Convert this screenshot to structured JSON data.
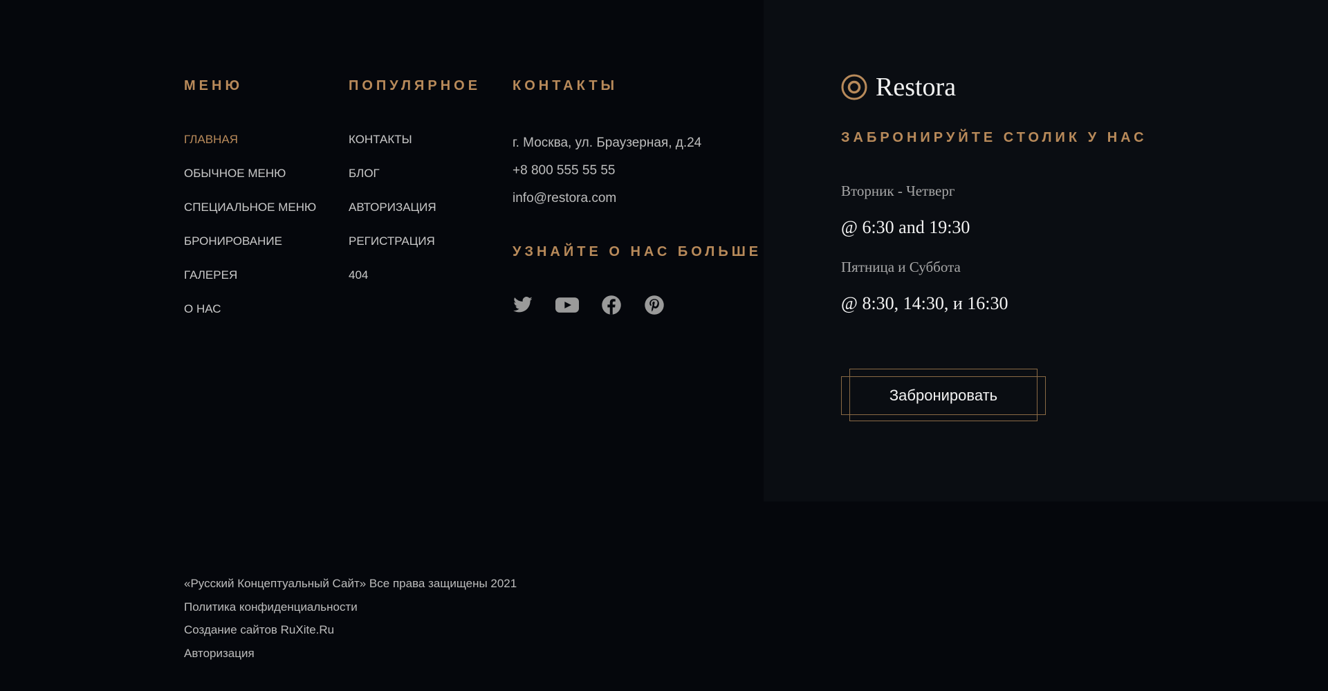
{
  "colors": {
    "accent": "#b88a5a",
    "background": "#05070c",
    "panel": "#0a0d12",
    "text": "#c9c9c9",
    "text_bright": "#f2f2f2"
  },
  "menu": {
    "heading": "МЕНЮ",
    "items": [
      {
        "label": "ГЛАВНАЯ",
        "active": true
      },
      {
        "label": "ОБЫЧНОЕ МЕНЮ"
      },
      {
        "label": "СПЕЦИАЛЬНОЕ МЕНЮ"
      },
      {
        "label": "БРОНИРОВАНИЕ"
      },
      {
        "label": "ГАЛЕРЕЯ"
      },
      {
        "label": "О НАС"
      }
    ]
  },
  "popular": {
    "heading": "ПОПУЛЯРНОЕ",
    "items": [
      {
        "label": "КОНТАКТЫ"
      },
      {
        "label": "БЛОГ"
      },
      {
        "label": "АВТОРИЗАЦИЯ"
      },
      {
        "label": "РЕГИСТРАЦИЯ"
      },
      {
        "label": "404"
      }
    ]
  },
  "contacts": {
    "heading": "КОНТАКТЫ",
    "address": "г. Москва, ул. Браузерная, д.24",
    "phone": "+8 800 555 55 55",
    "email": "info@restora.com"
  },
  "social": {
    "heading": "УЗНАЙТЕ О НАС БОЛЬШЕ",
    "icons": [
      "twitter-icon",
      "youtube-icon",
      "facebook-icon",
      "pinterest-icon"
    ]
  },
  "reservation": {
    "brand": "Restora",
    "heading": "ЗАБРОНИРУЙТЕ СТОЛИК У НАС",
    "schedule": [
      {
        "days": "Вторник - Четверг",
        "times": "@ 6:30 and 19:30"
      },
      {
        "days": "Пятница и Суббота",
        "times": "@ 8:30, 14:30, и 16:30"
      }
    ],
    "button_label": "Забронировать"
  },
  "footer": {
    "copyright": "«Русский Концептуальный Сайт» Все права защищены 2021",
    "privacy": "Политика конфиденциальности",
    "credits": "Создание сайтов RuXite.Ru",
    "login": "Авторизация"
  }
}
